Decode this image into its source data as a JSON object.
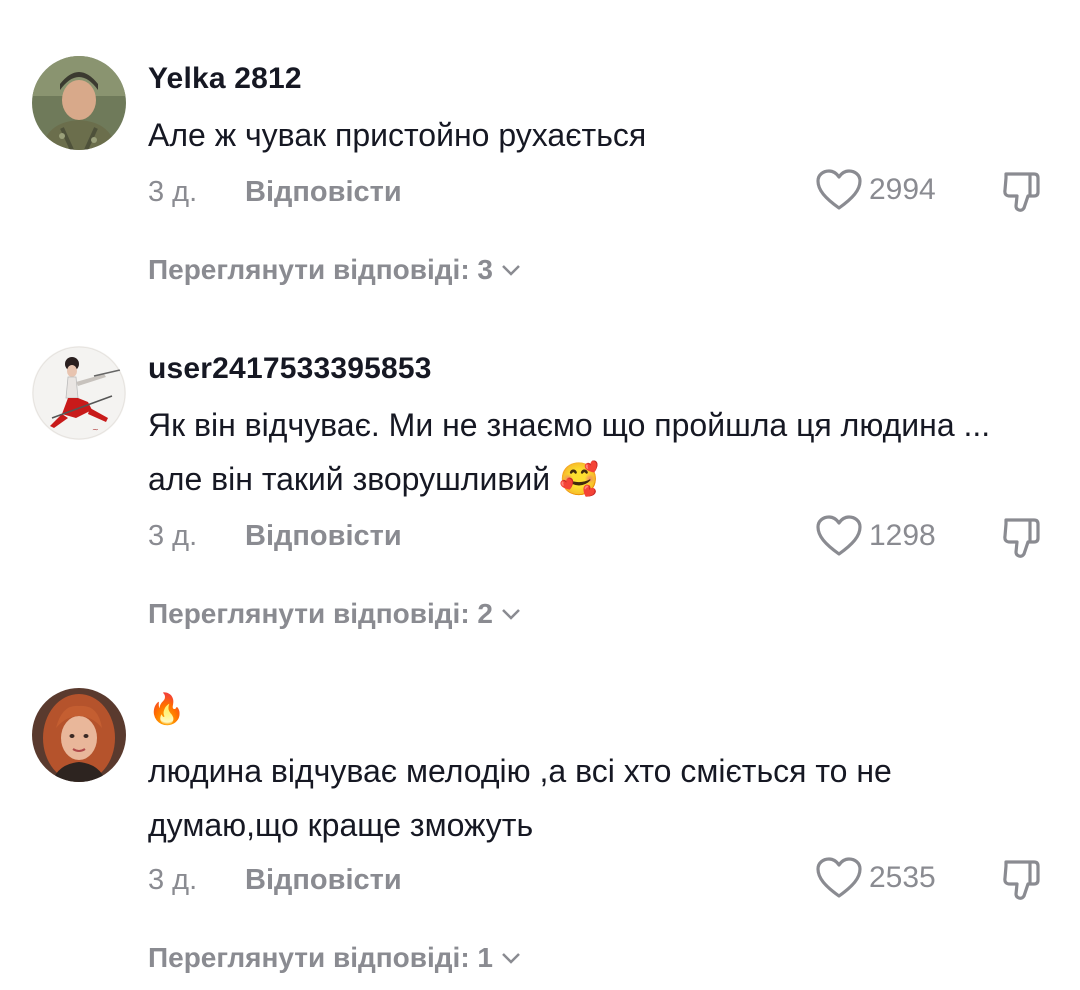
{
  "comments": [
    {
      "username": "Yelka 2812",
      "text": "Але ж чувак пристойно рухається",
      "time": "3 д.",
      "reply_label": "Відповісти",
      "likes": "2994",
      "view_replies": "Переглянути відповіді: 3",
      "avatar_icon": "avatar-military-woman"
    },
    {
      "username": "user2417533395853",
      "text": "Як він відчуває. Ми не знаємо що пройшла ця людина ... але він такий зворушливий",
      "emoji": "🥰",
      "time": "3 д.",
      "reply_label": "Відповісти",
      "likes": "1298",
      "view_replies": "Переглянути відповіді: 2",
      "avatar_icon": "avatar-dancer-illustration"
    },
    {
      "username": "🔥",
      "text": "людина відчуває мелодію ,а всі хто сміється то не думаю,що краще зможуть",
      "time": "3 д.",
      "reply_label": "Відповісти",
      "likes": "2535",
      "view_replies": "Переглянути відповіді: 1",
      "avatar_icon": "avatar-redhead-woman"
    }
  ],
  "colors": {
    "text_primary": "#161823",
    "text_secondary": "#8a8b91",
    "background": "#ffffff"
  }
}
